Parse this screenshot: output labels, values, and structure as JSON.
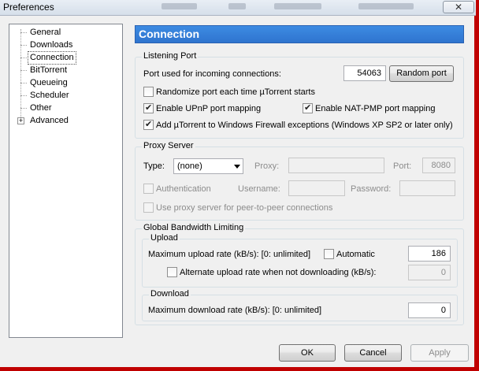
{
  "window": {
    "title": "Preferences",
    "close_symbol": "✕"
  },
  "tree": {
    "items": [
      {
        "label": "General"
      },
      {
        "label": "Downloads"
      },
      {
        "label": "Connection"
      },
      {
        "label": "BitTorrent"
      },
      {
        "label": "Queueing"
      },
      {
        "label": "Scheduler"
      },
      {
        "label": "Other"
      },
      {
        "label": "Advanced"
      }
    ],
    "expander_symbol": "+"
  },
  "header": {
    "title": "Connection"
  },
  "listening": {
    "legend": "Listening Port",
    "port_label": "Port used for incoming connections:",
    "port_value": "54063",
    "random_port_button": "Random port",
    "randomize_label": "Randomize port each time µTorrent starts",
    "randomize_checked": false,
    "upnp_label": "Enable UPnP port mapping",
    "upnp_checked": true,
    "natpmp_label": "Enable NAT-PMP port mapping",
    "natpmp_checked": true,
    "firewall_label": "Add µTorrent to Windows Firewall exceptions (Windows XP SP2 or later only)",
    "firewall_checked": true
  },
  "proxy": {
    "legend": "Proxy Server",
    "type_label": "Type:",
    "type_value": "(none)",
    "proxy_label": "Proxy:",
    "port_label": "Port:",
    "port_value": "8080",
    "auth_label": "Authentication",
    "username_label": "Username:",
    "password_label": "Password:",
    "p2p_label": "Use proxy server for peer-to-peer connections"
  },
  "bandwidth": {
    "legend": "Global Bandwidth Limiting",
    "upload_legend": "Upload",
    "max_upload_label": "Maximum upload rate (kB/s): [0: unlimited]",
    "automatic_label": "Automatic",
    "automatic_checked": false,
    "max_upload_value": "186",
    "alt_upload_label": "Alternate upload rate when not downloading (kB/s):",
    "alt_upload_checked": false,
    "alt_upload_value": "0",
    "download_legend": "Download",
    "max_download_label": "Maximum download rate (kB/s): [0: unlimited]",
    "max_download_value": "0"
  },
  "buttons": {
    "ok": "OK",
    "cancel": "Cancel",
    "apply": "Apply"
  }
}
